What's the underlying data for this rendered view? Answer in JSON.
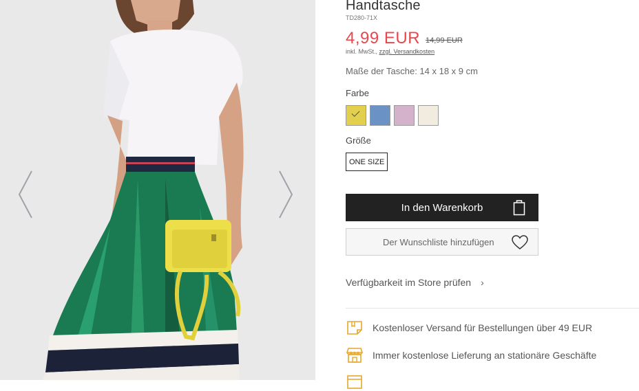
{
  "gallery": {
    "prev_icon": "chevron-left-icon",
    "next_icon": "chevron-right-icon"
  },
  "product": {
    "title": "Handtasche",
    "sku": "TD280-71X",
    "price": "4,99 EUR",
    "old_price": "14,99 EUR",
    "tax_prefix": "inkl. MwSt.,",
    "shipping_link": "zzgl. Versandkosten",
    "dimensions": "Maße der Tasche: 14 x 18 x 9 cm",
    "color_label": "Farbe",
    "colors": [
      {
        "hex": "#e3cf4e",
        "selected": true
      },
      {
        "hex": "#6b92c4",
        "selected": false
      },
      {
        "hex": "#d4b2cc",
        "selected": false
      },
      {
        "hex": "#f1ebe0",
        "selected": false
      }
    ],
    "size_label": "Größe",
    "size_value": "ONE SIZE",
    "add_to_cart": "In den Warenkorb",
    "add_to_wishlist": "Der Wunschliste hinzufügen",
    "store_availability": "Verfügbarkeit im Store prüfen"
  },
  "benefits": [
    {
      "icon": "free-shipping-box-icon",
      "text": "Kostenloser Versand für Bestellungen über 49 EUR"
    },
    {
      "icon": "store-icon",
      "text": "Immer kostenlose Lieferung an stationäre Geschäfte"
    },
    {
      "icon": "calendar-icon",
      "text": ""
    }
  ],
  "colors": {
    "accent_price": "#e8474d",
    "button_dark": "#222222",
    "benefit_icon": "#e8a62a"
  }
}
